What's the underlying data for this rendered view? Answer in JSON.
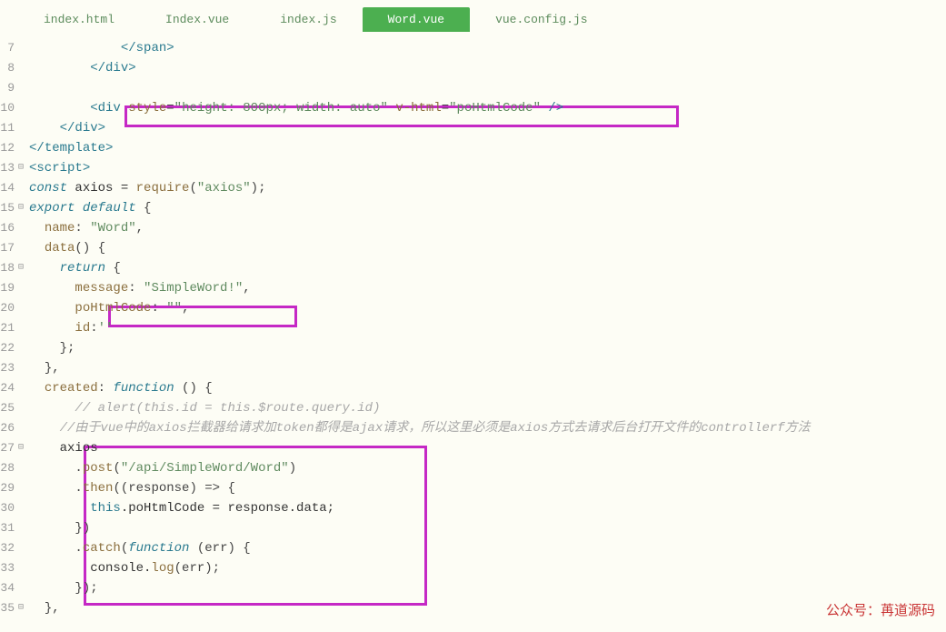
{
  "tabs": [
    {
      "label": "index.html",
      "active": false
    },
    {
      "label": "Index.vue",
      "active": false
    },
    {
      "label": "index.js",
      "active": false
    },
    {
      "label": "Word.vue",
      "active": true
    },
    {
      "label": "vue.config.js",
      "active": false
    }
  ],
  "lines": [
    {
      "num": "7",
      "fold": "",
      "indent": "            ",
      "tokens": [
        {
          "t": "</",
          "c": "c-tag"
        },
        {
          "t": "span",
          "c": "c-tag"
        },
        {
          "t": ">",
          "c": "c-tag"
        }
      ]
    },
    {
      "num": "8",
      "fold": "",
      "indent": "        ",
      "tokens": [
        {
          "t": "</",
          "c": "c-tag"
        },
        {
          "t": "div",
          "c": "c-tag"
        },
        {
          "t": ">",
          "c": "c-tag"
        }
      ]
    },
    {
      "num": "9",
      "fold": "",
      "indent": "",
      "tokens": []
    },
    {
      "num": "10",
      "fold": "",
      "indent": "        ",
      "tokens": [
        {
          "t": "<",
          "c": "c-tag"
        },
        {
          "t": "div",
          "c": "c-tag"
        },
        {
          "t": " ",
          "c": ""
        },
        {
          "t": "style",
          "c": "c-attr"
        },
        {
          "t": "=",
          "c": "c-punc"
        },
        {
          "t": "\"height: 800px; width: auto\"",
          "c": "c-val"
        },
        {
          "t": " ",
          "c": ""
        },
        {
          "t": "v-html",
          "c": "c-attr"
        },
        {
          "t": "=",
          "c": "c-punc"
        },
        {
          "t": "\"poHtmlCode\"",
          "c": "c-val"
        },
        {
          "t": " />",
          "c": "c-tag"
        }
      ]
    },
    {
      "num": "11",
      "fold": "",
      "indent": "    ",
      "tokens": [
        {
          "t": "</",
          "c": "c-tag"
        },
        {
          "t": "div",
          "c": "c-tag"
        },
        {
          "t": ">",
          "c": "c-tag"
        }
      ]
    },
    {
      "num": "12",
      "fold": "",
      "indent": "",
      "tokens": [
        {
          "t": "</",
          "c": "c-tag"
        },
        {
          "t": "template",
          "c": "c-tag"
        },
        {
          "t": ">",
          "c": "c-tag"
        }
      ]
    },
    {
      "num": "13",
      "fold": "⊟",
      "indent": "",
      "tokens": [
        {
          "t": "<",
          "c": "c-tag"
        },
        {
          "t": "script",
          "c": "c-tag"
        },
        {
          "t": ">",
          "c": "c-tag"
        }
      ]
    },
    {
      "num": "14",
      "fold": "",
      "indent": "",
      "tokens": [
        {
          "t": "const",
          "c": "c-kw"
        },
        {
          "t": " axios = ",
          "c": ""
        },
        {
          "t": "require",
          "c": "c-fn"
        },
        {
          "t": "(",
          "c": "c-punc"
        },
        {
          "t": "\"axios\"",
          "c": "c-str"
        },
        {
          "t": ");",
          "c": "c-punc"
        }
      ]
    },
    {
      "num": "15",
      "fold": "⊟",
      "indent": "",
      "tokens": [
        {
          "t": "export",
          "c": "c-kw"
        },
        {
          "t": " ",
          "c": ""
        },
        {
          "t": "default",
          "c": "c-kw"
        },
        {
          "t": " {",
          "c": "c-punc"
        }
      ]
    },
    {
      "num": "16",
      "fold": "",
      "indent": "  ",
      "tokens": [
        {
          "t": "name",
          "c": "c-prop"
        },
        {
          "t": ": ",
          "c": "c-punc"
        },
        {
          "t": "\"Word\"",
          "c": "c-str"
        },
        {
          "t": ",",
          "c": "c-punc"
        }
      ]
    },
    {
      "num": "17",
      "fold": "",
      "indent": "  ",
      "tokens": [
        {
          "t": "data",
          "c": "c-fn"
        },
        {
          "t": "() {",
          "c": "c-punc"
        }
      ]
    },
    {
      "num": "18",
      "fold": "⊟",
      "indent": "    ",
      "tokens": [
        {
          "t": "return",
          "c": "c-kw"
        },
        {
          "t": " {",
          "c": "c-punc"
        }
      ]
    },
    {
      "num": "19",
      "fold": "",
      "indent": "      ",
      "tokens": [
        {
          "t": "message",
          "c": "c-prop"
        },
        {
          "t": ": ",
          "c": "c-punc"
        },
        {
          "t": "\"SimpleWord!\"",
          "c": "c-str"
        },
        {
          "t": ",",
          "c": "c-punc"
        }
      ]
    },
    {
      "num": "20",
      "fold": "",
      "indent": "      ",
      "tokens": [
        {
          "t": "poHtmlCode",
          "c": "c-prop"
        },
        {
          "t": ": ",
          "c": "c-punc"
        },
        {
          "t": "\"\"",
          "c": "c-str"
        },
        {
          "t": ",",
          "c": "c-punc"
        }
      ]
    },
    {
      "num": "21",
      "fold": "",
      "indent": "      ",
      "tokens": [
        {
          "t": "id",
          "c": "c-prop"
        },
        {
          "t": ":",
          "c": "c-punc"
        },
        {
          "t": "''",
          "c": "c-str"
        }
      ]
    },
    {
      "num": "22",
      "fold": "",
      "indent": "    ",
      "tokens": [
        {
          "t": "};",
          "c": "c-punc"
        }
      ]
    },
    {
      "num": "23",
      "fold": "",
      "indent": "  ",
      "tokens": [
        {
          "t": "},",
          "c": "c-punc"
        }
      ]
    },
    {
      "num": "24",
      "fold": "",
      "indent": "  ",
      "tokens": [
        {
          "t": "created",
          "c": "c-prop"
        },
        {
          "t": ": ",
          "c": "c-punc"
        },
        {
          "t": "function",
          "c": "c-kw"
        },
        {
          "t": " () {",
          "c": "c-punc"
        }
      ]
    },
    {
      "num": "25",
      "fold": "",
      "indent": "      ",
      "tokens": [
        {
          "t": "// alert(this.id = this.$route.query.id)",
          "c": "c-cmt"
        }
      ]
    },
    {
      "num": "26",
      "fold": "",
      "indent": "    ",
      "tokens": [
        {
          "t": "//由于vue中的axios拦截器给请求加token都得是ajax请求，所以这里必须是axios方式去请求后台打开文件的controllerf方法",
          "c": "c-cmt"
        }
      ]
    },
    {
      "num": "27",
      "fold": "⊟",
      "indent": "    ",
      "tokens": [
        {
          "t": "axios",
          "c": ""
        }
      ]
    },
    {
      "num": "28",
      "fold": "",
      "indent": "      ",
      "tokens": [
        {
          "t": ".",
          "c": "c-punc"
        },
        {
          "t": "post",
          "c": "c-fn"
        },
        {
          "t": "(",
          "c": "c-punc"
        },
        {
          "t": "\"/api/SimpleWord/Word\"",
          "c": "c-str"
        },
        {
          "t": ")",
          "c": "c-punc"
        }
      ]
    },
    {
      "num": "29",
      "fold": "",
      "indent": "      ",
      "tokens": [
        {
          "t": ".",
          "c": "c-punc"
        },
        {
          "t": "then",
          "c": "c-fn"
        },
        {
          "t": "((response) => {",
          "c": "c-punc"
        }
      ]
    },
    {
      "num": "30",
      "fold": "",
      "indent": "        ",
      "tokens": [
        {
          "t": "this",
          "c": "c-this"
        },
        {
          "t": ".poHtmlCode = response.data;",
          "c": ""
        }
      ]
    },
    {
      "num": "31",
      "fold": "",
      "indent": "      ",
      "tokens": [
        {
          "t": "})",
          "c": "c-punc"
        }
      ]
    },
    {
      "num": "32",
      "fold": "",
      "indent": "      ",
      "tokens": [
        {
          "t": ".",
          "c": "c-punc"
        },
        {
          "t": "catch",
          "c": "c-fn"
        },
        {
          "t": "(",
          "c": "c-punc"
        },
        {
          "t": "function",
          "c": "c-kw"
        },
        {
          "t": " (err) {",
          "c": "c-punc"
        }
      ]
    },
    {
      "num": "33",
      "fold": "",
      "indent": "        ",
      "tokens": [
        {
          "t": "console.",
          "c": ""
        },
        {
          "t": "log",
          "c": "c-fn"
        },
        {
          "t": "(err);",
          "c": "c-punc"
        }
      ]
    },
    {
      "num": "34",
      "fold": "",
      "indent": "      ",
      "tokens": [
        {
          "t": "});",
          "c": "c-punc"
        }
      ]
    },
    {
      "num": "35",
      "fold": "⊟",
      "indent": "  ",
      "tokens": [
        {
          "t": "},",
          "c": "c-punc"
        }
      ]
    }
  ],
  "watermark": "公众号：苒道源码"
}
